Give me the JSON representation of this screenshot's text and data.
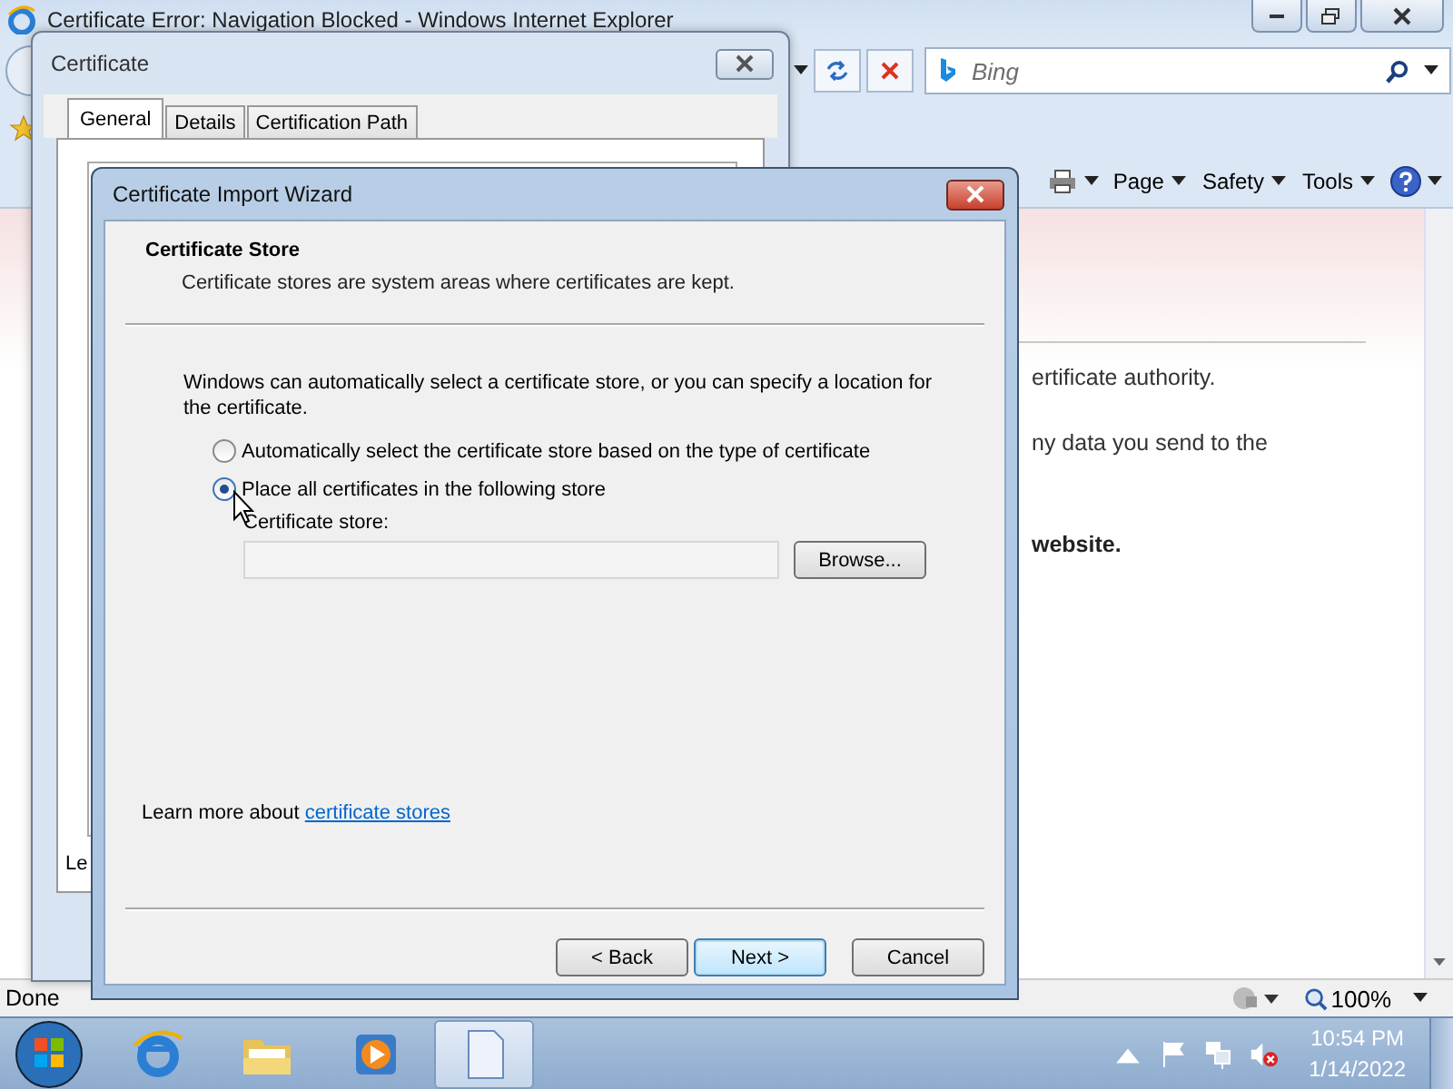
{
  "browser": {
    "title": "Certificate Error: Navigation Blocked - Windows Internet Explorer",
    "search": {
      "placeholder": "Bing"
    },
    "command_menus": [
      "Page",
      "Safety",
      "Tools"
    ],
    "page_lines": [
      {
        "text": "ertificate authority.",
        "bold": false
      },
      {
        "text": "ny data you send to the",
        "bold": false
      },
      {
        "text": "website.",
        "bold": true
      }
    ],
    "status": "Done",
    "zoom": "100%"
  },
  "certificate_dialog": {
    "title": "Certificate",
    "tabs": [
      {
        "label": "General",
        "selected": true
      },
      {
        "label": "Details",
        "selected": false
      },
      {
        "label": "Certification Path",
        "selected": false
      }
    ],
    "panel_fragment": "Le"
  },
  "wizard": {
    "title": "Certificate Import Wizard",
    "heading": "Certificate Store",
    "subheading": "Certificate stores are system areas where certificates are kept.",
    "intro": "Windows can automatically select a certificate store, or you can specify a location for the certificate.",
    "options": [
      {
        "label": "Automatically select the certificate store based on the type of certificate",
        "selected": false
      },
      {
        "label": "Place all certificates in the following store",
        "selected": true
      }
    ],
    "store_field": {
      "label": "Certificate store:",
      "disabled": true
    },
    "browse_button": "Browse...",
    "learn_more": {
      "text": "Learn more about",
      "link": "certificate stores"
    },
    "buttons": [
      {
        "label": "< Back",
        "default": false
      },
      {
        "label": "Next >",
        "default": true
      },
      {
        "label": "Cancel",
        "default": false
      }
    ]
  },
  "taskbar": {
    "apps": [
      {
        "kind": "browser",
        "selected": false
      },
      {
        "kind": "folder",
        "selected": false
      },
      {
        "kind": "media",
        "selected": false
      },
      {
        "kind": "document",
        "selected": true
      }
    ],
    "time": "10:54 PM",
    "date": "1/14/2022"
  }
}
